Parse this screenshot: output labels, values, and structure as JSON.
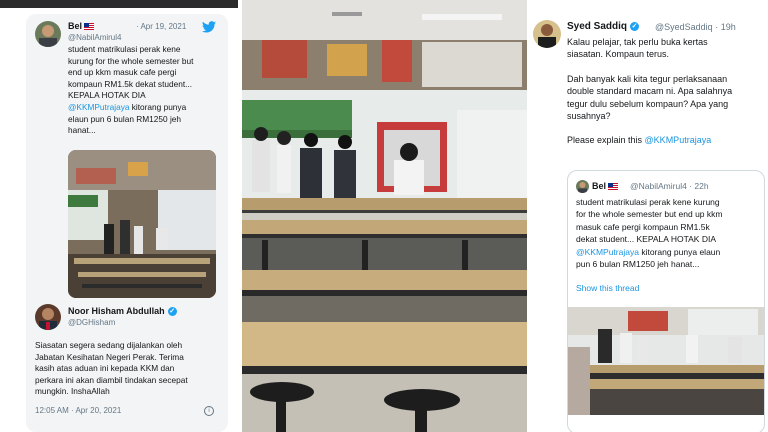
{
  "tweet1": {
    "name": "Bel",
    "date": "Apr 19, 2021",
    "handle": "@NabilAmirul4",
    "lines": [
      "student matrikulasi perak kene",
      "kurung for the whole semester but",
      "end up kkm masuk cafe pergi",
      "kompaun RM1.5k dekat student...",
      "KEPALA HOTAK DIA"
    ],
    "mention": "@KKMPutrajaya",
    "mention_rest": " kitorang punya",
    "lines2": [
      "elaun pun 6 bulan RM1250 jeh",
      "hanat..."
    ]
  },
  "tweet2": {
    "name": "Noor Hisham Abdullah",
    "handle": "@DGHisham",
    "lines": [
      "Siasatan segera sedang dijalankan oleh",
      "Jabatan Kesihatan Negeri Perak. Terima",
      "kasih atas aduan ini kepada KKM dan",
      "perkara ini akan diambil tindakan secepat",
      "mungkin. InshaAllah"
    ],
    "timestamp": "12:05 AM · Apr 20, 2021",
    "info_icon": "info-icon"
  },
  "tweet3": {
    "name": "Syed Saddiq",
    "handle": "@SyedSaddiq",
    "age": "· 19h",
    "para1": [
      "Kalau pelajar, tak perlu buka kertas",
      "siasatan. Kompaun terus."
    ],
    "para2": [
      "Dah banyak kali kita tegur perlaksanaan",
      "double standard macam ni. Apa salahnya",
      "tegur dulu sebelum kompaun? Apa yang",
      "susahnya?"
    ],
    "explain_prefix": "Please explain this ",
    "explain_mention": "@KKMPutrajaya",
    "verified_icon": "verified-badge-icon"
  },
  "quoted": {
    "name": "Bel",
    "handle": "@NabilAmirul4",
    "age": "· 22h",
    "lines": [
      "student matrikulasi perak kene kurung",
      "for the whole semester but end up kkm",
      "masuk cafe pergi kompaun RM1.5k",
      "dekat student... KEPALA HOTAK DIA"
    ],
    "mention": "@KKMPutrajaya",
    "mention_rest": " kitorang punya elaun",
    "last_line": "pun 6 bulan RM1250 jeh hanat...",
    "show_thread": "Show this thread"
  },
  "colors": {
    "twitter_blue": "#1da1f2",
    "link": "#1b95e0",
    "muted": "#657786",
    "card_bg": "#f2f4f5"
  }
}
